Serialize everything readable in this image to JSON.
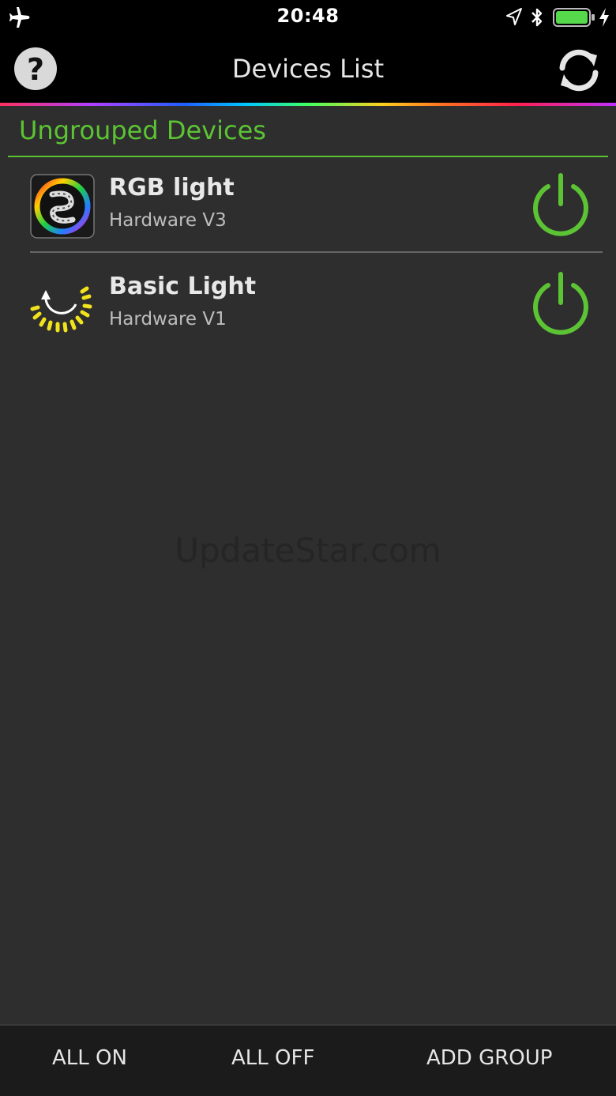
{
  "status_bar": {
    "time": "20:48",
    "battery_color": "#55d84a"
  },
  "nav_bar": {
    "title": "Devices List",
    "help_label": "?"
  },
  "group": {
    "header": "Ungrouped Devices",
    "accent_color": "#5cc434"
  },
  "devices": [
    {
      "name": "RGB light",
      "hardware": "Hardware V3",
      "icon": "rgb-strip-icon",
      "power": "on"
    },
    {
      "name": "Basic Light",
      "hardware": "Hardware V1",
      "icon": "basic-light-icon",
      "power": "on"
    }
  ],
  "watermark": "UpdateStar.com",
  "bottom_bar": {
    "all_on": "ALL ON",
    "all_off": "ALL OFF",
    "add_group": "ADD GROUP"
  }
}
